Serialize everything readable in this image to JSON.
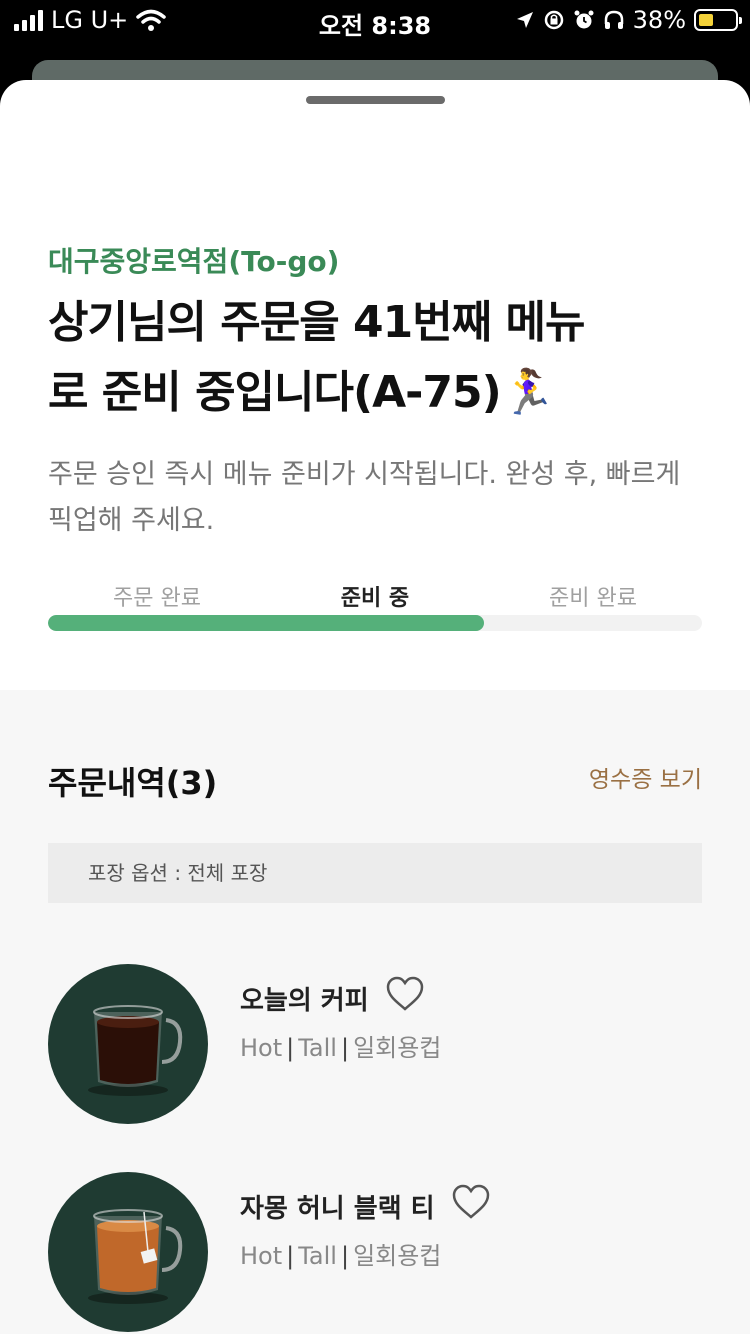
{
  "status_bar": {
    "carrier": "LG U+",
    "time": "오전 8:38",
    "battery_percent": "38%",
    "battery_level": 0.38
  },
  "order_status": {
    "store_name": "대구중앙로역점(To-go)",
    "headline_line1": "상기님의 주문을 41번째 메뉴",
    "headline_line2": "로 준비 중입니다(A-75)🏃‍♀️",
    "subtitle": "주문 승인 즉시 메뉴 준비가 시작됩니다. 완성 후, 빠르게 픽업해 주세요.",
    "steps": [
      "주문 완료",
      "준비 중",
      "준비 완료"
    ],
    "active_step": 1,
    "progress_fraction": 0.667,
    "accent_color": "#55b07a",
    "store_color": "#3a8a57"
  },
  "order_history": {
    "title": "주문내역(3)",
    "receipt_link": "영수증 보기",
    "pack_option": "포장 옵션 : 전체 포장",
    "items": [
      {
        "name": "오늘의 커피",
        "temp": "Hot",
        "size": "Tall",
        "cup": "일회용컵",
        "icon": "coffee-mug-icon"
      },
      {
        "name": "자몽 허니 블랙 티",
        "temp": "Hot",
        "size": "Tall",
        "cup": "일회용컵",
        "icon": "tea-mug-icon"
      }
    ]
  }
}
